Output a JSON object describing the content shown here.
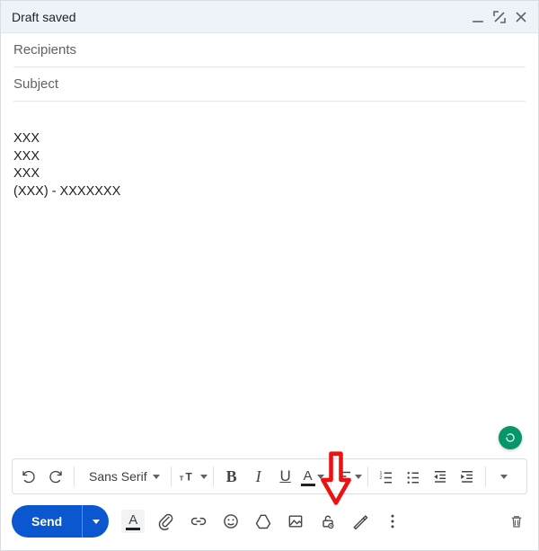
{
  "header": {
    "title": "Draft saved"
  },
  "fields": {
    "recipients_placeholder": "Recipients",
    "subject_placeholder": "Subject"
  },
  "body_text": "XXX\nXXX\nXXX\n(XXX) - XXXXXXX",
  "format": {
    "font_family_label": "Sans Serif"
  },
  "send": {
    "label": "Send"
  }
}
